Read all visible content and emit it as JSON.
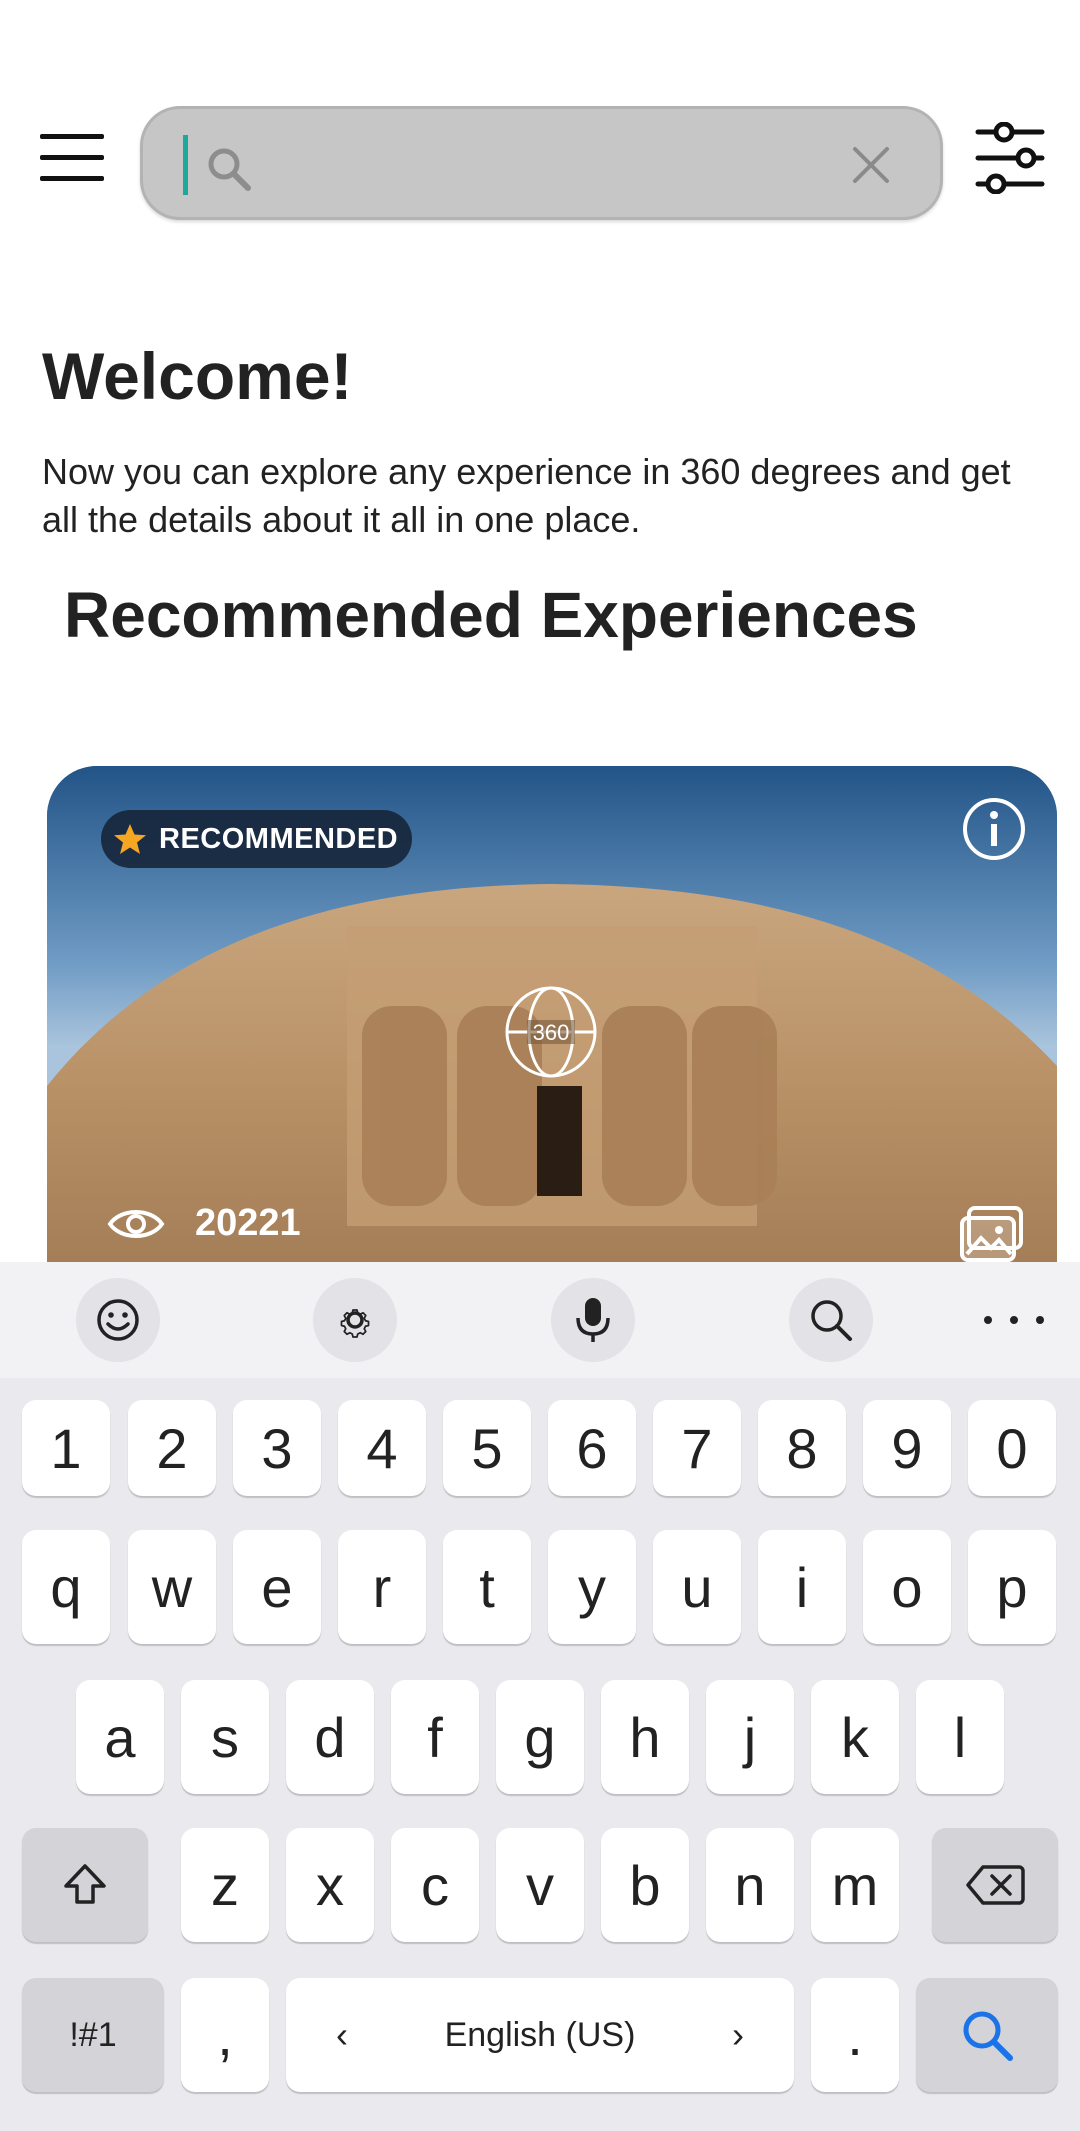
{
  "header": {
    "menu_icon": "hamburger-menu-icon",
    "search": {
      "value": "",
      "placeholder": ""
    },
    "clear_icon": "close-icon",
    "filter_icon": "sliders-icon"
  },
  "welcome": {
    "title": "Welcome!",
    "text": "Now you can explore any experience in 360 degrees and get all the details about it all in one place."
  },
  "section": {
    "title": "Recommended Experiences"
  },
  "card": {
    "badge": "RECOMMENDED",
    "badge_icon": "star-icon",
    "icon_360_label": "360",
    "views": "20221",
    "info_icon": "info-icon",
    "gallery_icon": "gallery-icon",
    "accent_star_color": "#f5a623"
  },
  "keyboard": {
    "toolbar": [
      "emoji-icon",
      "settings-icon",
      "mic-icon",
      "search-icon",
      "more-icon"
    ],
    "row_numbers": [
      "1",
      "2",
      "3",
      "4",
      "5",
      "6",
      "7",
      "8",
      "9",
      "0"
    ],
    "row_q": [
      "q",
      "w",
      "e",
      "r",
      "t",
      "y",
      "u",
      "i",
      "o",
      "p"
    ],
    "row_a": [
      "a",
      "s",
      "d",
      "f",
      "g",
      "h",
      "j",
      "k",
      "l"
    ],
    "row_z": [
      "z",
      "x",
      "c",
      "v",
      "b",
      "n",
      "m"
    ],
    "symbols_label": "!#1",
    "comma_label": ",",
    "space_label": "English (US)",
    "space_left": "‹",
    "space_right": "›",
    "period_label": ".",
    "search_key_color": "#1a73e8"
  }
}
